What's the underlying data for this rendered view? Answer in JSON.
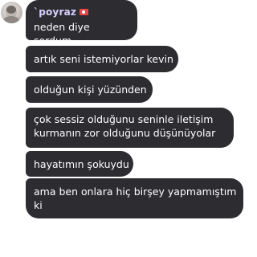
{
  "sender": {
    "name": "`poyraz",
    "flag_icon": "flag-icon",
    "avatar_icon": "avatar"
  },
  "messages": [
    "neden diye sordum",
    "artık seni istemiyorlar kevin",
    "olduğun kişi yüzünden",
    "çok sessiz olduğunu seninle iletişim kurmanın zor olduğunu düşünüyolar",
    "hayatımın şokuydu",
    "ama ben onlara hiç birşey yapmamıştım ki"
  ],
  "colors": {
    "bubble": "#2d2c31",
    "text": "#ffffff",
    "name": "#d7d0ff",
    "background": "#ffffff"
  }
}
